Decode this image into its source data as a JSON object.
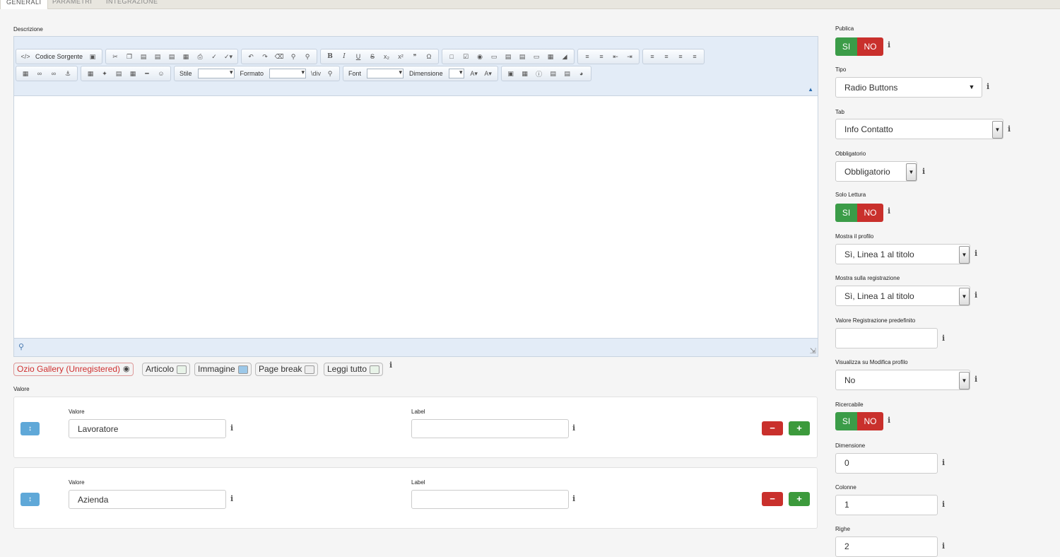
{
  "tabs": [
    "Generali",
    "Parametri",
    "Integrazione"
  ],
  "editor": {
    "label": "Descrizione",
    "source_button": "Codice Sorgente",
    "style_label": "Stile",
    "format_label": "Formato",
    "font_label": "Font",
    "size_label": "Dimensione"
  },
  "plugin_buttons": [
    "Ozio Gallery (Unregistered)",
    "Articolo",
    "Immagine",
    "Page break",
    "Leggi tutto"
  ],
  "values_section": {
    "label": "Valore",
    "rows": [
      {
        "valore_label": "Valore",
        "valore": "Lavoratore",
        "label_label": "Label",
        "label": ""
      },
      {
        "valore_label": "Valore",
        "valore": "Azienda",
        "label_label": "Label",
        "label": ""
      }
    ]
  },
  "info_glyph": "i",
  "sidebar": {
    "pubblica_label": "Publica",
    "toggle_si": "SI",
    "toggle_no": "NO",
    "tipo_label": "Tipo",
    "tipo_value": "Radio Buttons",
    "tab_label": "Tab",
    "tab_value": "Info Contatto",
    "obbligatorio_label": "Obbligatorio",
    "obbligatorio_value": "Obbligatorio",
    "solo_lettura_label": "Solo Lettura",
    "mostra_profilo_label": "Mostra il profilo",
    "mostra_profilo_value": "Sì, Linea 1 al titolo",
    "mostra_registrazione_label": "Mostra sulla registrazione",
    "mostra_registrazione_value": "Sì, Linea 1 al titolo",
    "valore_reg_label": "Valore Registrazione predefinito",
    "valore_reg_value": "",
    "visualizza_label": "Visualizza su Modifica profilo",
    "visualizza_value": "No",
    "ricercabile_label": "Ricercabile",
    "dimensione_label": "Dimensione",
    "dimensione_value": "0",
    "colonne_label": "Colonne",
    "colonne_value": "1",
    "righe_label": "Righe",
    "righe_value": "2"
  },
  "colors": {
    "green": "#3b9c48",
    "red": "#c9302c",
    "blue": "#5fa8d8"
  }
}
